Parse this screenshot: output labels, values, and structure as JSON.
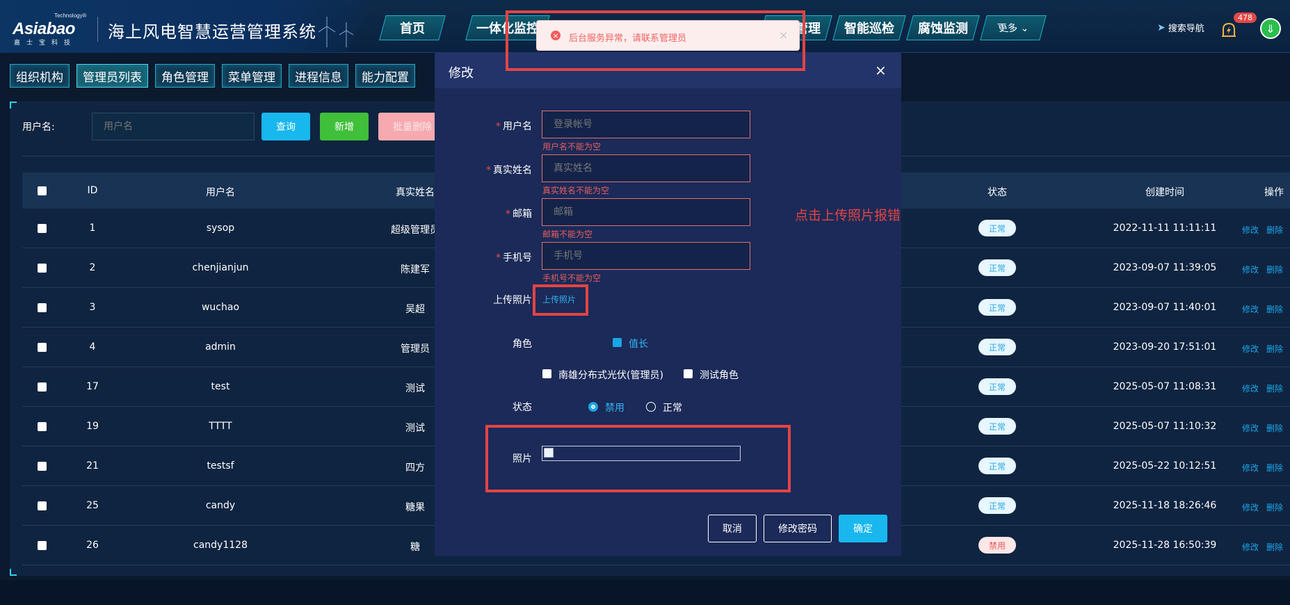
{
  "header": {
    "logo_tech": "Technology®",
    "logo_main": "Asiabao",
    "logo_sub": "嘉士宝科技",
    "system_title": "海上风电智慧运营管理系统",
    "nav": [
      {
        "label": "首页"
      },
      {
        "label": "一体化监控"
      },
      {
        "label": "故障管理"
      },
      {
        "label": "智能巡检"
      },
      {
        "label": "腐蚀监测"
      },
      {
        "label": "更多"
      }
    ],
    "search_nav": "搜索导航",
    "badge_count": "478",
    "colors": {
      "accent": "#18b7ed",
      "danger": "#e34444",
      "success": "#3fbf3a"
    }
  },
  "subtabs": [
    {
      "label": "组织机构"
    },
    {
      "label": "管理员列表"
    },
    {
      "label": "角色管理"
    },
    {
      "label": "菜单管理"
    },
    {
      "label": "进程信息"
    },
    {
      "label": "能力配置"
    }
  ],
  "filter": {
    "label": "用户名:",
    "placeholder": "用户名",
    "query": "查询",
    "add": "新增",
    "batch_delete": "批量删除"
  },
  "table": {
    "headers": {
      "id": "ID",
      "username": "用户名",
      "realname": "真实姓名",
      "status": "状态",
      "created": "创建时间",
      "ops": "操作"
    },
    "rows": [
      {
        "id": "1",
        "username": "sysop",
        "realname": "超级管理员",
        "status": "正常",
        "created": "2022-11-11 11:11:11"
      },
      {
        "id": "2",
        "username": "chenjianjun",
        "realname": "陈建军",
        "status": "正常",
        "created": "2023-09-07 11:39:05"
      },
      {
        "id": "3",
        "username": "wuchao",
        "realname": "吴超",
        "status": "正常",
        "created": "2023-09-07 11:40:01"
      },
      {
        "id": "4",
        "username": "admin",
        "realname": "管理员",
        "status": "正常",
        "created": "2023-09-20 17:51:01"
      },
      {
        "id": "17",
        "username": "test",
        "realname": "测试",
        "status": "正常",
        "created": "2025-05-07 11:08:31"
      },
      {
        "id": "19",
        "username": "TTTT",
        "realname": "测试",
        "status": "正常",
        "created": "2025-05-07 11:10:32"
      },
      {
        "id": "21",
        "username": "testsf",
        "realname": "四方",
        "status": "正常",
        "created": "2025-05-22 10:12:51"
      },
      {
        "id": "25",
        "username": "candy",
        "realname": "糖果",
        "status": "正常",
        "created": "2025-11-18 18:26:46"
      },
      {
        "id": "26",
        "username": "candy1128",
        "realname": "糖",
        "status": "禁用",
        "created": "2025-11-28 16:50:39"
      }
    ],
    "edit": "修改",
    "delete": "删除"
  },
  "modal": {
    "title": "修改",
    "close": "×",
    "username_label": "用户名",
    "username_placeholder": "登录帐号",
    "username_error": "用户名不能为空",
    "realname_label": "真实姓名",
    "realname_placeholder": "真实姓名",
    "realname_error": "真实姓名不能为空",
    "email_label": "邮箱",
    "email_placeholder": "邮箱",
    "email_error": "邮箱不能为空",
    "phone_label": "手机号",
    "phone_placeholder": "手机号",
    "phone_error": "手机号不能为空",
    "upload_label": "上传照片",
    "upload_link": "上传照片",
    "role_label": "角色",
    "roles": [
      {
        "label": "值长",
        "checked": true
      },
      {
        "label": "南雄分布式光伏(管理员)",
        "checked": false
      },
      {
        "label": "测试角色",
        "checked": false
      }
    ],
    "status_label": "状态",
    "status_options": [
      {
        "label": "禁用",
        "selected": true
      },
      {
        "label": "正常",
        "selected": false
      }
    ],
    "photo_label": "照片",
    "cancel": "取消",
    "change_password": "修改密码",
    "confirm": "确定"
  },
  "toast": {
    "message": "后台服务异常，请联系管理员",
    "icon": "error-circle-icon"
  },
  "annotation": {
    "text": "点击上传照片报错"
  }
}
